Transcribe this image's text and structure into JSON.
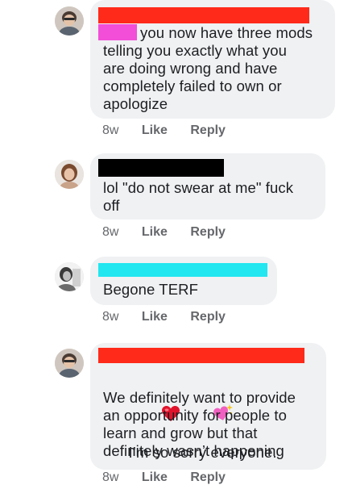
{
  "comments": [
    {
      "author_redaction_color": "#ff2a1a",
      "mention_redaction_color": "#f24ed8",
      "text_first_line": "you now have three mods",
      "text_rest": "telling you exactly what you\nare doing wrong and have\ncompletely failed to own or\napologize",
      "time": "8w",
      "like_label": "Like",
      "reply_label": "Reply"
    },
    {
      "author_redaction_color": "#000000",
      "text": "lol \"do not swear at me\" fuck\noff",
      "time": "8w",
      "like_label": "Like",
      "reply_label": "Reply"
    },
    {
      "author_redaction_color": "#22e6f0",
      "text": "Begone TERF",
      "time": "8w",
      "like_label": "Like",
      "reply_label": "Reply"
    },
    {
      "author_redaction_color": "#ff2a1a",
      "emojis": [
        "red-heart-icon",
        "sparkling-heart-icon"
      ],
      "text_first_line": "I’m so sorry everyone.",
      "text_rest": "We definitely want to provide\nan opportunity for people to\nlearn and grow but that\ndefinitely wasn’t happening",
      "time": "8w",
      "like_label": "Like",
      "reply_label": "Reply"
    }
  ]
}
